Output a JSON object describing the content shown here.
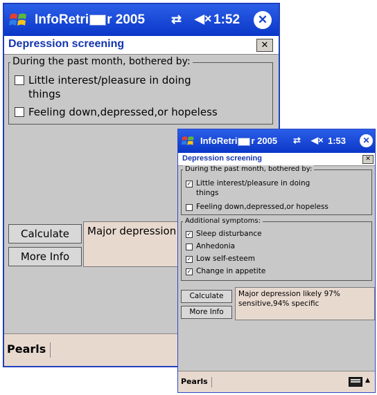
{
  "window_back": {
    "titlebar": {
      "title_left": "InfoRetri",
      "title_right": "r 2005",
      "conn": "⇄",
      "vol": "◀×",
      "time": "1:52",
      "close": "✕"
    },
    "caption": {
      "title": "Depression screening",
      "close": "✕"
    },
    "group1": {
      "legend": "During the past month, bothered by:",
      "item1_line1": "Little interest/pleasure in doing",
      "item1_line2": "things",
      "item2": "Feeling down,depressed,or hopeless"
    },
    "buttons": {
      "calculate": "Calculate",
      "more_info": "More Info"
    },
    "result": "Major depression",
    "bottombar": {
      "pearls": "Pearls"
    }
  },
  "window_front": {
    "titlebar": {
      "title_left": "InfoRetri",
      "title_right": "r 2005",
      "conn": "⇄",
      "vol": "◀×",
      "time": "1:53",
      "close": "✕"
    },
    "caption": {
      "title": "Depression screening",
      "close": "✕"
    },
    "group1": {
      "legend": "During the past month, bothered by:",
      "item1_line1": "Little interest/pleasure in doing",
      "item1_line2": "things",
      "item1_checked": true,
      "item2": "Feeling down,depressed,or hopeless",
      "item2_checked": false
    },
    "group2": {
      "legend": "Additional symptoms:",
      "items": [
        {
          "label": "Sleep disturbance",
          "checked": true
        },
        {
          "label": "Anhedonia",
          "checked": false
        },
        {
          "label": "Low self-esteem",
          "checked": true
        },
        {
          "label": "Change in appetite",
          "checked": true
        }
      ]
    },
    "buttons": {
      "calculate": "Calculate",
      "more_info": "More Info"
    },
    "result": "Major depression likely 97% sensitive,94% specific",
    "bottombar": {
      "pearls": "Pearls",
      "up": "▲"
    }
  },
  "colors": {
    "titlebar": "#1a45d6",
    "body": "#c8c8c8",
    "result_bg": "#e8d9cf",
    "caption_text": "#1334b0"
  },
  "check_mark": "✓"
}
